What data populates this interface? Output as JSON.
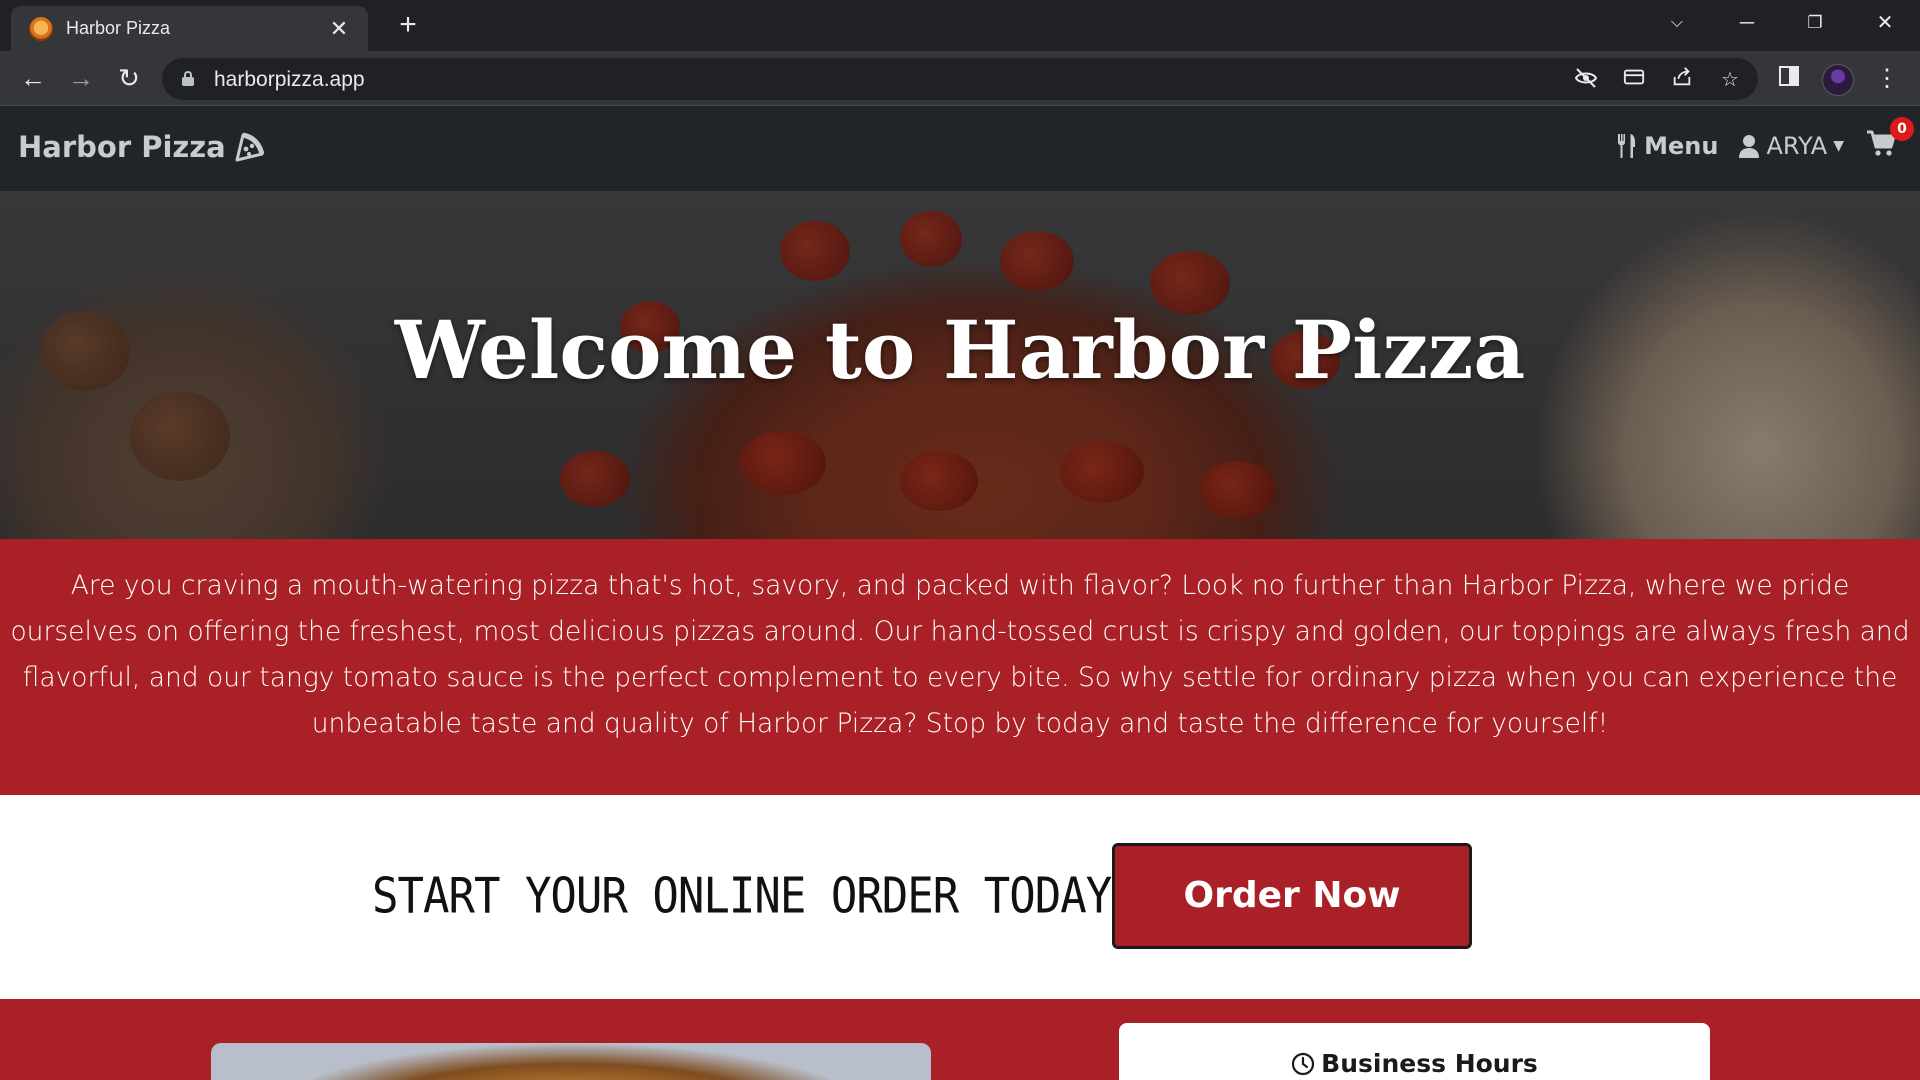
{
  "browser": {
    "tab_title": "Harbor Pizza",
    "url": "harborpizza.app"
  },
  "site": {
    "brand": "Harbor Pizza",
    "nav": {
      "menu_label": "Menu",
      "user_label": "ARYA",
      "cart_count": "0"
    },
    "hero": {
      "title": "Welcome to Harbor Pizza"
    },
    "intro": "Are you craving a mouth-watering pizza that's hot, savory, and packed with flavor? Look no further than Harbor Pizza, where we pride ourselves on offering the freshest, most delicious pizzas around. Our hand-tossed crust is crispy and golden, our toppings are always fresh and flavorful, and our tangy tomato sauce is the perfect complement to every bite. So why settle for ordinary pizza when you can experience the unbeatable taste and quality of Harbor Pizza? Stop by today and taste the difference for yourself!",
    "cta": {
      "text": "START YOUR ONLINE ORDER TODAY!",
      "button": "Order Now"
    },
    "hours": {
      "title": "Business Hours"
    }
  },
  "colors": {
    "brand_red": "#a92126",
    "navbar": "#212529",
    "badge": "#dc1a1a"
  },
  "icons": [
    "close-icon",
    "plus-icon",
    "back-icon",
    "forward-icon",
    "reload-icon",
    "lock-icon",
    "eye-off-icon",
    "card-icon",
    "share-icon",
    "star-icon",
    "sidepanel-icon",
    "more-icon",
    "pizza-slice-icon",
    "utensils-icon",
    "user-icon",
    "caret-down-icon",
    "cart-icon",
    "clock-icon"
  ]
}
